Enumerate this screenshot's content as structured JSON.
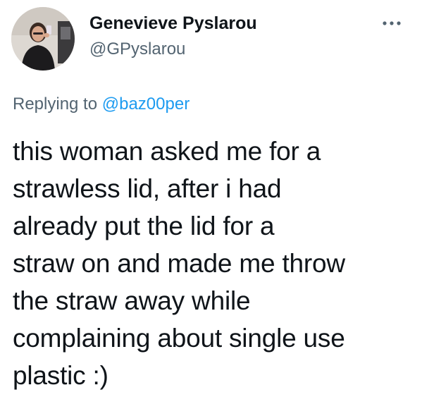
{
  "author": {
    "name": "Genevieve Pyslarou",
    "handle": "@GPyslarou",
    "avatar_icon": "profile-photo"
  },
  "menu": {
    "icon": "more-horizontal-icon"
  },
  "reply": {
    "prefix": "Replying to",
    "mention": "@baz00per"
  },
  "tweet": {
    "text": "this woman asked me for a\nstrawless lid, after i had\nalready put the lid for a\nstraw on and made me throw\nthe straw away while\ncomplaining about single use\nplastic :)"
  },
  "colors": {
    "primary_text": "#0f1419",
    "secondary_text": "#536471",
    "link": "#1d9bf0"
  }
}
